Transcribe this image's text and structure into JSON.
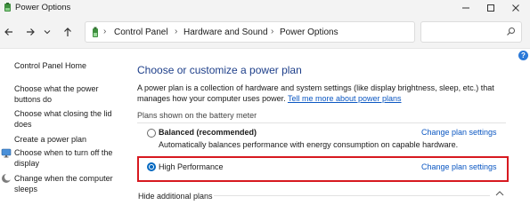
{
  "window": {
    "title": "Power Options"
  },
  "address": {
    "breadcrumbs": [
      "Control Panel",
      "Hardware and Sound",
      "Power Options"
    ]
  },
  "sidebar": {
    "links": [
      "Control Panel Home",
      "Choose what the power",
      "buttons do",
      "Choose what closing the lid",
      "does",
      "Create a power plan",
      "Choose when to turn off the",
      "display",
      "Change when the computer",
      "sleeps"
    ]
  },
  "main": {
    "heading": "Choose or customize a power plan",
    "description": "A power plan is a collection of hardware and system settings (like display brightness, sleep, etc.) that",
    "description_line2": "manages how your computer uses power.",
    "learn_more": "Tell me more about power plans",
    "section_label": "Plans shown on the battery meter",
    "plans": [
      {
        "name": "Balanced (recommended)",
        "description": "Automatically balances performance with energy consumption on capable hardware.",
        "link": "Change plan settings",
        "selected": false
      },
      {
        "name": "High Performance",
        "description": "",
        "link": "Change plan settings",
        "selected": true
      }
    ],
    "hide_additional": "Hide additional plans"
  },
  "colors": {
    "accent": "#0067c0",
    "link": "#0b57c2",
    "heading": "#1e3f8a",
    "highlight": "#d71920"
  },
  "icons": {
    "help": "?"
  }
}
